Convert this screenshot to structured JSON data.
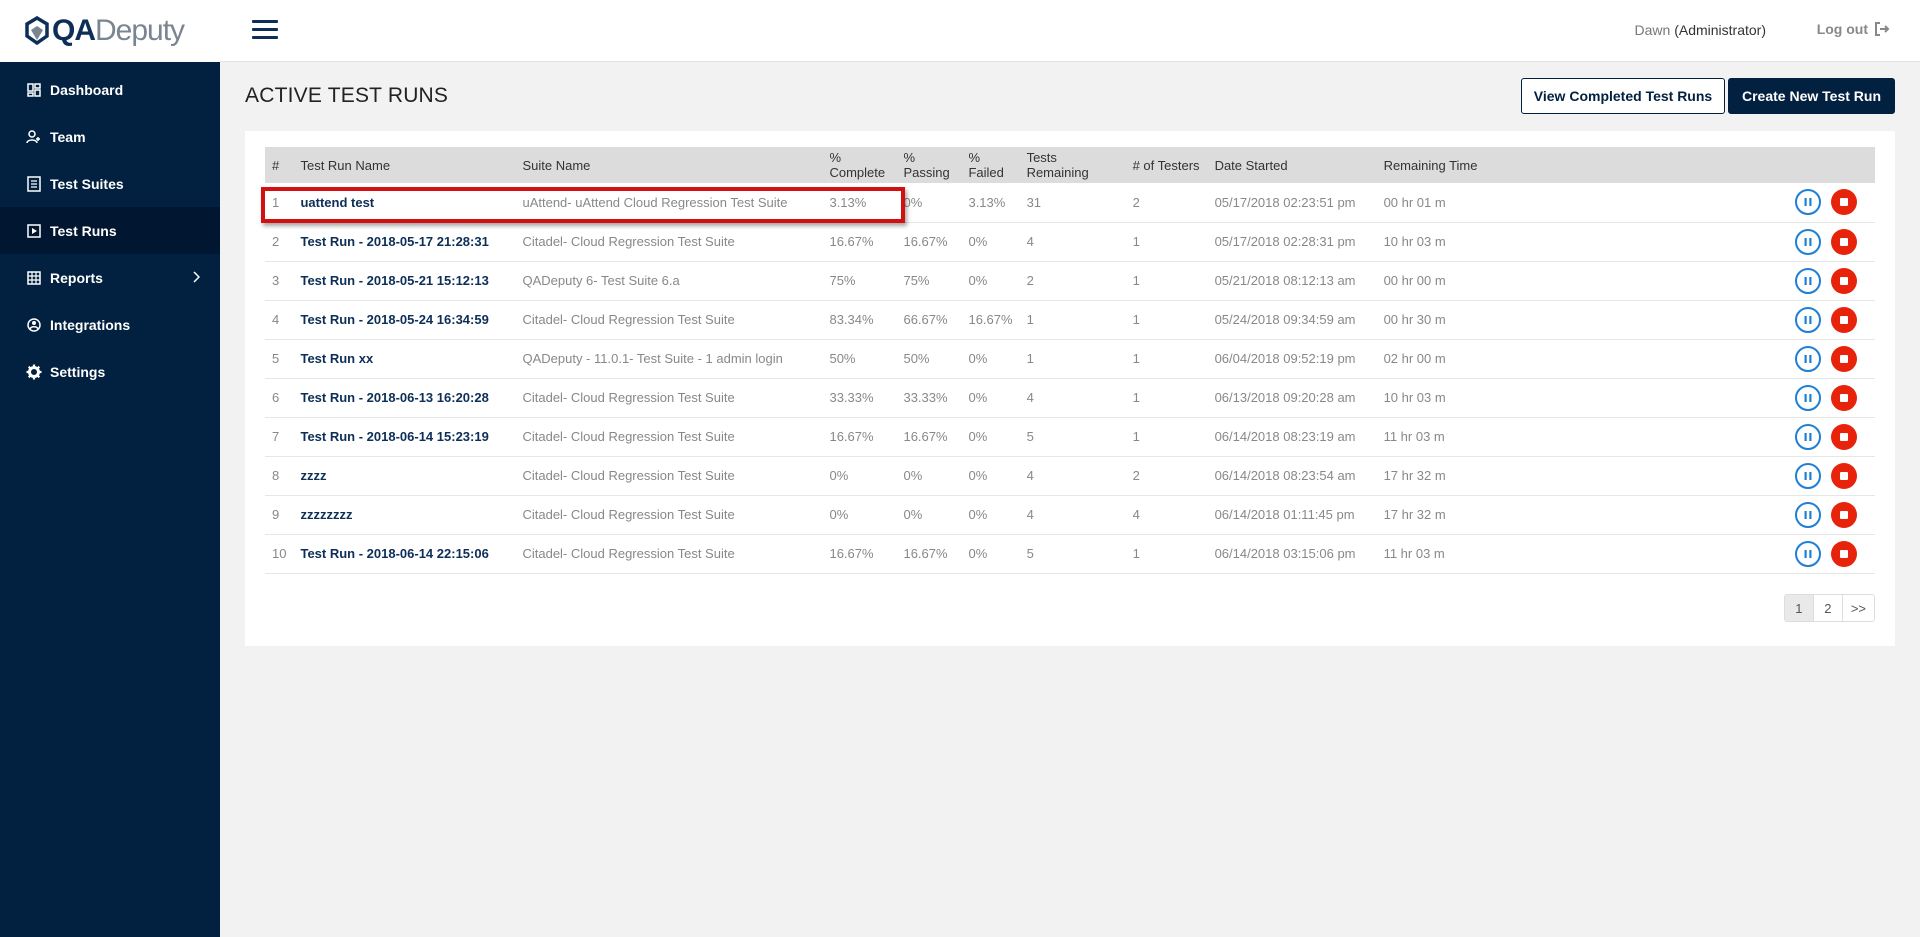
{
  "brand": {
    "logo_qa": "QA",
    "logo_rest": "Deputy"
  },
  "sidebar": {
    "items": [
      {
        "label": "Dashboard",
        "icon": "dashboard-icon"
      },
      {
        "label": "Team",
        "icon": "team-icon"
      },
      {
        "label": "Test Suites",
        "icon": "test-suites-icon"
      },
      {
        "label": "Test Runs",
        "icon": "test-runs-icon",
        "active": true
      },
      {
        "label": "Reports",
        "icon": "reports-icon"
      },
      {
        "label": "Integrations",
        "icon": "integrations-icon"
      },
      {
        "label": "Settings",
        "icon": "gear-icon"
      }
    ]
  },
  "header": {
    "user_name": "Dawn",
    "user_role": "(Administrator)",
    "logout_label": "Log out"
  },
  "page": {
    "title": "ACTIVE TEST RUNS",
    "view_completed_label": "View Completed Test Runs",
    "create_new_label": "Create New Test Run"
  },
  "table": {
    "columns": [
      "#",
      "Test Run Name",
      "Suite Name",
      "% Complete",
      "% Passing",
      "% Failed",
      "Tests Remaining",
      "# of Testers",
      "Date Started",
      "Remaining Time"
    ],
    "rows": [
      {
        "num": "1",
        "name": "uattend test",
        "suite": "uAttend- uAttend Cloud Regression Test Suite",
        "complete": "3.13%",
        "passing": "0%",
        "failed": "3.13%",
        "remaining": "31",
        "testers": "2",
        "started": "05/17/2018 02:23:51 pm",
        "time": "00 hr 01 m"
      },
      {
        "num": "2",
        "name": "Test Run - 2018-05-17 21:28:31",
        "suite": "Citadel- Cloud Regression Test Suite",
        "complete": "16.67%",
        "passing": "16.67%",
        "failed": "0%",
        "remaining": "4",
        "testers": "1",
        "started": "05/17/2018 02:28:31 pm",
        "time": "10 hr 03 m"
      },
      {
        "num": "3",
        "name": "Test Run - 2018-05-21 15:12:13",
        "suite": "QADeputy 6- Test Suite 6.a",
        "complete": "75%",
        "passing": "75%",
        "failed": "0%",
        "remaining": "2",
        "testers": "1",
        "started": "05/21/2018 08:12:13 am",
        "time": "00 hr 00 m"
      },
      {
        "num": "4",
        "name": "Test Run - 2018-05-24 16:34:59",
        "suite": "Citadel- Cloud Regression Test Suite",
        "complete": "83.34%",
        "passing": "66.67%",
        "failed": "16.67%",
        "remaining": "1",
        "testers": "1",
        "started": "05/24/2018 09:34:59 am",
        "time": "00 hr 30 m"
      },
      {
        "num": "5",
        "name": "Test Run xx",
        "suite": "QADeputy - 11.0.1- Test Suite - 1 admin login",
        "complete": "50%",
        "passing": "50%",
        "failed": "0%",
        "remaining": "1",
        "testers": "1",
        "started": "06/04/2018 09:52:19 pm",
        "time": "02 hr 00 m"
      },
      {
        "num": "6",
        "name": "Test Run - 2018-06-13 16:20:28",
        "suite": "Citadel- Cloud Regression Test Suite",
        "complete": "33.33%",
        "passing": "33.33%",
        "failed": "0%",
        "remaining": "4",
        "testers": "1",
        "started": "06/13/2018 09:20:28 am",
        "time": "10 hr 03 m"
      },
      {
        "num": "7",
        "name": "Test Run - 2018-06-14 15:23:19",
        "suite": "Citadel- Cloud Regression Test Suite",
        "complete": "16.67%",
        "passing": "16.67%",
        "failed": "0%",
        "remaining": "5",
        "testers": "1",
        "started": "06/14/2018 08:23:19 am",
        "time": "11 hr 03 m"
      },
      {
        "num": "8",
        "name": "zzzz",
        "suite": "Citadel- Cloud Regression Test Suite",
        "complete": "0%",
        "passing": "0%",
        "failed": "0%",
        "remaining": "4",
        "testers": "2",
        "started": "06/14/2018 08:23:54 am",
        "time": "17 hr 32 m"
      },
      {
        "num": "9",
        "name": "zzzzzzzz",
        "suite": "Citadel- Cloud Regression Test Suite",
        "complete": "0%",
        "passing": "0%",
        "failed": "0%",
        "remaining": "4",
        "testers": "4",
        "started": "06/14/2018 01:11:45 pm",
        "time": "17 hr 32 m"
      },
      {
        "num": "10",
        "name": "Test Run - 2018-06-14 22:15:06",
        "suite": "Citadel- Cloud Regression Test Suite",
        "complete": "16.67%",
        "passing": "16.67%",
        "failed": "0%",
        "remaining": "5",
        "testers": "1",
        "started": "06/14/2018 03:15:06 pm",
        "time": "11 hr 03 m"
      }
    ]
  },
  "pagination": {
    "pages": [
      "1",
      "2"
    ],
    "current": "1",
    "next_label": ">>"
  },
  "colors": {
    "sidebar_bg": "#02203f",
    "primary": "#02203f",
    "pause": "#1e7fd6",
    "stop": "#e8230b",
    "highlight": "#d31010"
  }
}
